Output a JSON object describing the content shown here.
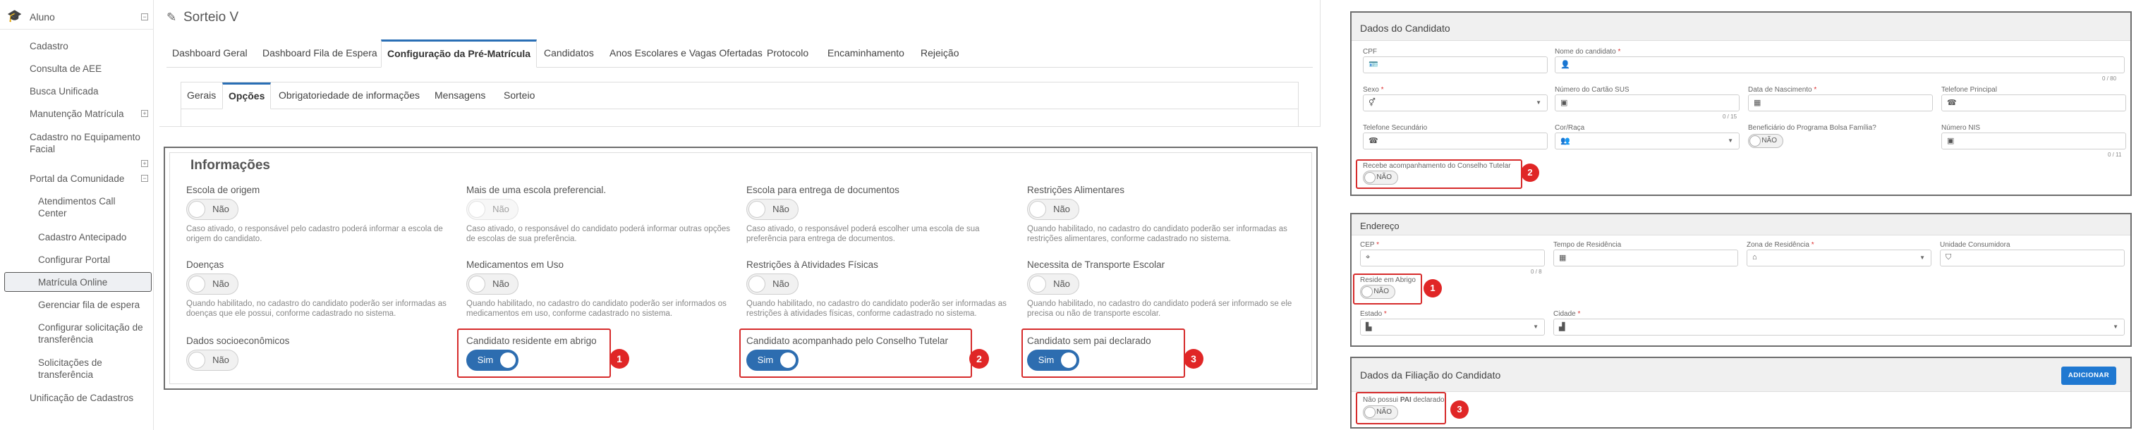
{
  "sidebar": {
    "section_title": "Aluno",
    "items": [
      {
        "label": "Cadastro"
      },
      {
        "label": "Consulta de AEE"
      },
      {
        "label": "Busca Unificada"
      },
      {
        "label": "Manutenção Matrícula"
      },
      {
        "label": "Cadastro no Equipamento Facial"
      },
      {
        "label": "Portal da Comunidade"
      },
      {
        "label": "Atendimentos Call Center"
      },
      {
        "label": "Cadastro Antecipado"
      },
      {
        "label": "Configurar Portal"
      },
      {
        "label": "Matrícula Online"
      },
      {
        "label": "Gerenciar fila de espera"
      },
      {
        "label": "Configurar solicitação de transferência"
      },
      {
        "label": "Solicitações de transferência"
      },
      {
        "label": "Unificação de Cadastros"
      }
    ]
  },
  "page": {
    "title": "Sorteio V"
  },
  "main_tabs": [
    "Dashboard Geral",
    "Dashboard Fila de Espera",
    "Configuração da Pré-Matrícula",
    "Candidatos",
    "Anos Escolares e Vagas Ofertadas",
    "Protocolo",
    "Encaminhamento",
    "Rejeição"
  ],
  "sub_tabs": [
    "Gerais",
    "Opções",
    "Obrigatoriedade de informações",
    "Mensagens",
    "Sorteio"
  ],
  "info": {
    "title": "Informações",
    "fields": [
      {
        "label": "Escola de origem",
        "value": "Não",
        "desc": "Caso ativado, o responsável pelo cadastro poderá informar a escola de origem do candidato."
      },
      {
        "label": "Mais de uma escola preferencial.",
        "value": "Não",
        "desc": "Caso ativado, o responsável do candidato poderá informar outras opções de escolas de sua preferência."
      },
      {
        "label": "Escola para entrega de documentos",
        "value": "Não",
        "desc": "Caso ativado, o responsável poderá escolher uma escola de sua preferência para entrega de documentos."
      },
      {
        "label": "Restrições Alimentares",
        "value": "Não",
        "desc": "Quando habilitado, no cadastro do candidato poderão ser informadas as restrições alimentares, conforme cadastrado no sistema."
      },
      {
        "label": "Doenças",
        "value": "Não",
        "desc": "Quando habilitado, no cadastro do candidato poderão ser informadas as doenças que ele possui, conforme cadastrado no sistema."
      },
      {
        "label": "Medicamentos em Uso",
        "value": "Não",
        "desc": "Quando habilitado, no cadastro do candidato poderão ser informados os medicamentos em uso, conforme cadastrado no sistema."
      },
      {
        "label": "Restrições à Atividades Físicas",
        "value": "Não",
        "desc": "Quando habilitado, no cadastro do candidato poderão ser informadas as restrições à atividades físicas, conforme cadastrado no sistema."
      },
      {
        "label": "Necessita de Transporte Escolar",
        "value": "Não",
        "desc": "Quando habilitado, no cadastro do candidato poderá ser informado se ele precisa ou não de transporte escolar."
      },
      {
        "label": "Dados socioeconômicos",
        "value": "Não",
        "desc": ""
      },
      {
        "label": "Candidato residente em abrigo",
        "value": "Sim",
        "desc": "",
        "badge": "1"
      },
      {
        "label": "Candidato acompanhado pelo Conselho Tutelar",
        "value": "Sim",
        "desc": "",
        "badge": "2"
      },
      {
        "label": "Candidato sem pai declarado",
        "value": "Sim",
        "desc": "",
        "badge": "3"
      }
    ]
  },
  "candidato": {
    "title": "Dados do Candidato",
    "labels": {
      "cpf": "CPF",
      "nome": "Nome do candidato",
      "nome_count": "0 / 80",
      "sexo": "Sexo",
      "sus": "Número do Cartão SUS",
      "sus_count": "0 / 15",
      "nasc": "Data de Nascimento",
      "tel": "Telefone Principal",
      "tel2": "Telefone Secundário",
      "cor": "Cor/Raça",
      "bolsa": "Beneficiário do Programa Bolsa Família?",
      "bolsa_val": "NÃO",
      "nis": "Número NIS",
      "nis_count": "0 / 11",
      "conselho": "Recebe acompanhamento do Conselho Tutelar",
      "conselho_val": "NÃO",
      "conselho_badge": "2"
    }
  },
  "endereco": {
    "title": "Endereço",
    "labels": {
      "cep": "CEP",
      "cep_count": "0 / 8",
      "tempo": "Tempo de Residência",
      "zona": "Zona de Residência",
      "unidade": "Unidade Consumidora",
      "abrigo": "Reside em Abrigo",
      "abrigo_val": "NÃO",
      "abrigo_badge": "1",
      "estado": "Estado",
      "cidade": "Cidade"
    }
  },
  "filiacao": {
    "title": "Dados da Filiação do Candidato",
    "add_button": "ADICIONAR",
    "pai_prefix": "Não possui ",
    "pai_bold": "PAI",
    "pai_suffix": " declarado",
    "pai_val": "NÃO",
    "pai_badge": "3"
  }
}
